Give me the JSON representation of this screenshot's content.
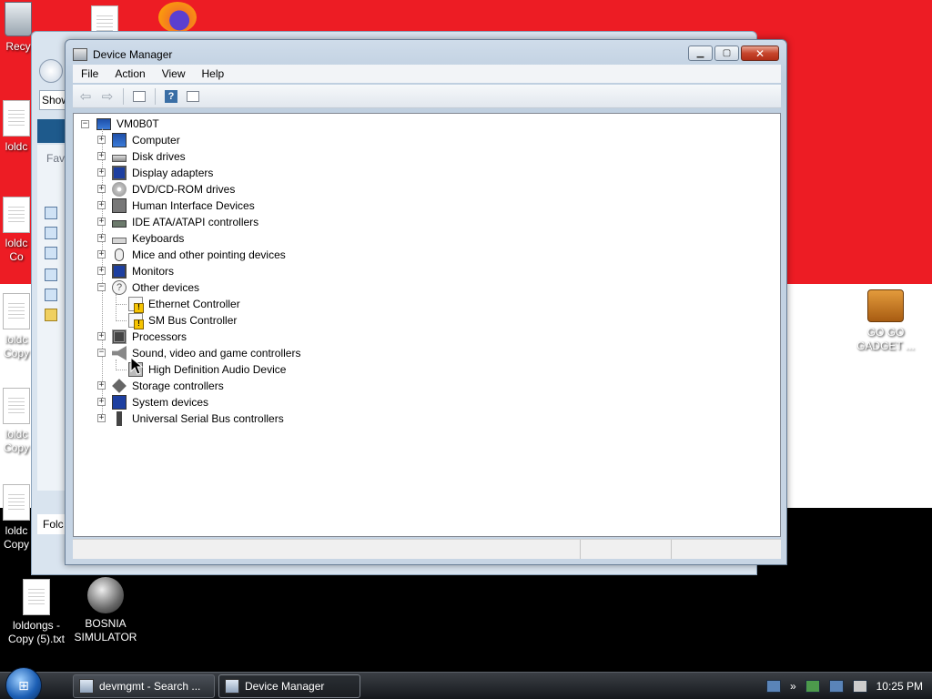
{
  "colors": {
    "flag_red": "#ed1c24",
    "flag_white": "#ffffff",
    "flag_black": "#000000"
  },
  "desktop": {
    "left_icons": [
      {
        "name": "recycle-bin",
        "label": "Recy"
      },
      {
        "name": "file-1",
        "label": "loldc"
      },
      {
        "name": "file-2",
        "label": "loldc",
        "label2": "Co"
      },
      {
        "name": "file-3",
        "label": "loldc",
        "label2": "Copy"
      },
      {
        "name": "file-4",
        "label": "loldc",
        "label2": "Copy"
      },
      {
        "name": "file-5",
        "label": "loldc",
        "label2": "Copy"
      }
    ],
    "bottom_icons": [
      {
        "label": "loldongs -",
        "label2": "Copy (5).txt"
      },
      {
        "label": "BOSNIA",
        "label2": "SIMULATOR"
      }
    ],
    "right_icon": {
      "label": "GO GO",
      "label2": "GADGET ..."
    }
  },
  "back_window": {
    "search_text": "Show",
    "favorites_text": "Fav",
    "folders_text": "Folc"
  },
  "device_manager": {
    "title": "Device Manager",
    "menu": [
      "File",
      "Action",
      "View",
      "Help"
    ],
    "root": "VM0B0T",
    "categories": [
      {
        "label": "Computer",
        "icon": "computer-icon",
        "expanded": false
      },
      {
        "label": "Disk drives",
        "icon": "disk-drive-icon",
        "expanded": false
      },
      {
        "label": "Display adapters",
        "icon": "display-adapter-icon",
        "expanded": false
      },
      {
        "label": "DVD/CD-ROM drives",
        "icon": "dvd-icon",
        "expanded": false
      },
      {
        "label": "Human Interface Devices",
        "icon": "hid-icon",
        "expanded": false
      },
      {
        "label": "IDE ATA/ATAPI controllers",
        "icon": "ide-icon",
        "expanded": false
      },
      {
        "label": "Keyboards",
        "icon": "keyboard-icon",
        "expanded": false
      },
      {
        "label": "Mice and other pointing devices",
        "icon": "mouse-icon",
        "expanded": false
      },
      {
        "label": "Monitors",
        "icon": "monitor-icon",
        "expanded": false
      },
      {
        "label": "Other devices",
        "icon": "other-devices-icon",
        "expanded": true,
        "children": [
          "Ethernet Controller",
          "SM Bus Controller"
        ]
      },
      {
        "label": "Processors",
        "icon": "processor-icon",
        "expanded": false
      },
      {
        "label": "Sound, video and game controllers",
        "icon": "sound-icon",
        "expanded": true,
        "children": [
          "High Definition Audio Device"
        ]
      },
      {
        "label": "Storage controllers",
        "icon": "storage-icon",
        "expanded": false
      },
      {
        "label": "System devices",
        "icon": "system-devices-icon",
        "expanded": false
      },
      {
        "label": "Universal Serial Bus controllers",
        "icon": "usb-icon",
        "expanded": false
      }
    ]
  },
  "taskbar": {
    "buttons": [
      {
        "label": "devmgmt - Search ...",
        "active": false
      },
      {
        "label": "Device Manager",
        "active": true
      }
    ],
    "clock": "10:25 PM"
  }
}
